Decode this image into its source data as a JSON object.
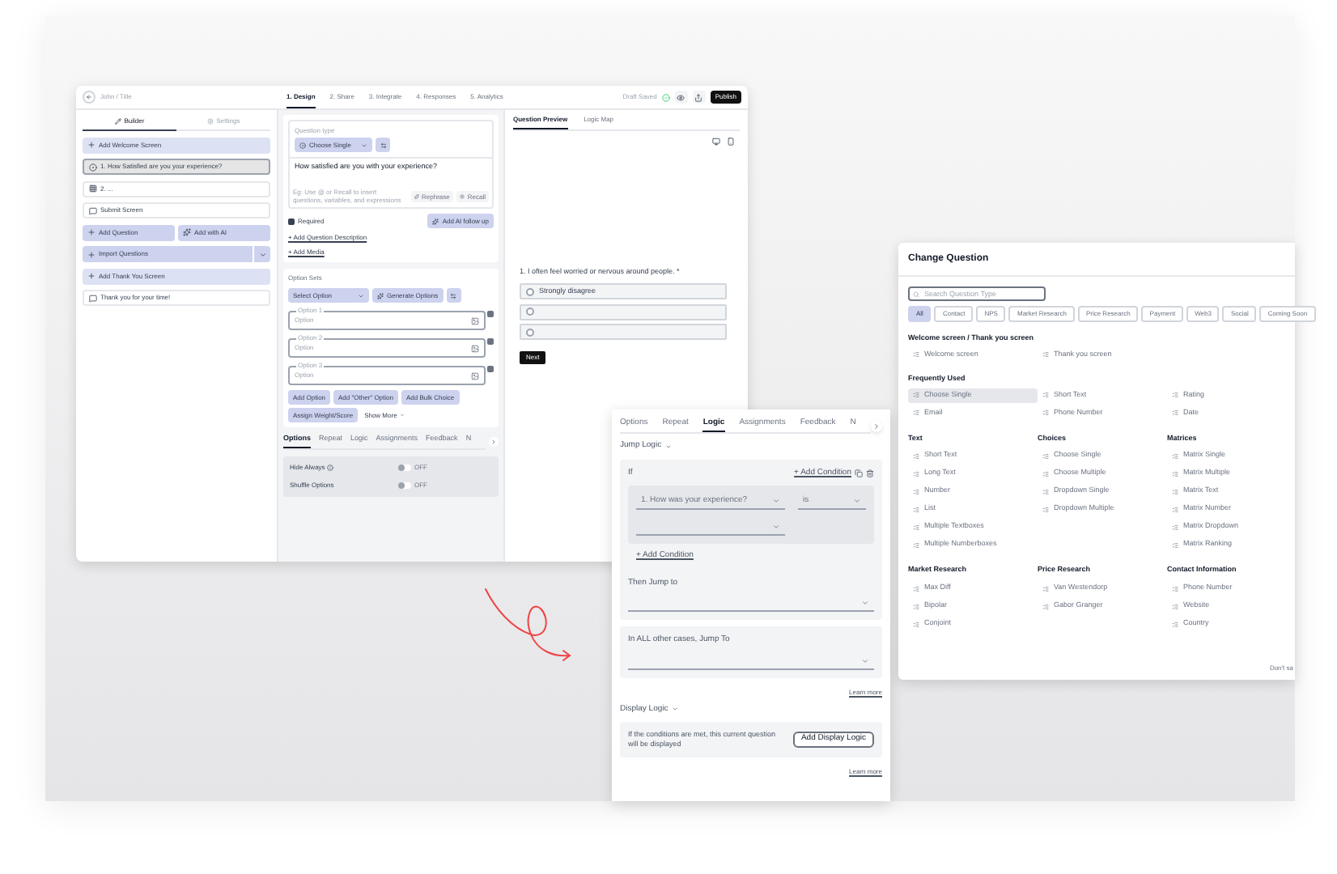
{
  "editor": {
    "breadcrumb": "John / Title",
    "steps": [
      {
        "label": "1. Design",
        "selected": true
      },
      {
        "label": "2. Share",
        "selected": false
      },
      {
        "label": "3. Integrate",
        "selected": false
      },
      {
        "label": "4. Responses",
        "selected": false
      },
      {
        "label": "5. Analytics",
        "selected": false
      }
    ],
    "draft_status": "Draft Saved",
    "publish_button": "Publish",
    "sidebar": {
      "tabs": [
        {
          "label": "Builder",
          "selected": true
        },
        {
          "label": "Settings",
          "selected": false
        }
      ],
      "items": [
        {
          "kind": "add",
          "label": "Add Welcome Screen"
        },
        {
          "kind": "choice",
          "label": "1. How Satisfied are you your experience?",
          "selected": true
        },
        {
          "kind": "matrix",
          "label": "2. ...",
          "selected": false
        },
        {
          "kind": "screen",
          "label": "Submit Screen",
          "selected": false
        },
        {
          "kind": "pair",
          "labels": [
            "Add Question",
            "Add with AI"
          ]
        },
        {
          "kind": "split",
          "label": "Import Questions"
        },
        {
          "kind": "add",
          "label": "Add Thank You Screen"
        },
        {
          "kind": "screen",
          "label": "Thank you for your time!",
          "selected": false
        }
      ]
    },
    "question_card": {
      "type_label": "Question type",
      "type_value": "Choose Single",
      "question_text": "How satisfied are you with your experience?",
      "hint": "Eg: Use @ or Recall to insert questions, variables, and expressions",
      "rephrase_button": "Rephrase",
      "recall_button": "Recall",
      "required": {
        "label": "Required",
        "checked": true
      },
      "ai_button": "Add AI follow up",
      "links": [
        "+ Add Question Description",
        "+ Add Media"
      ]
    },
    "options_card": {
      "label": "Option Sets",
      "select": "Select Option",
      "generate_button": "Generate Options",
      "options": [
        {
          "label": "Option 1",
          "placeholder": "Option"
        },
        {
          "label": "Option 2",
          "placeholder": "Option"
        },
        {
          "label": "Option 3",
          "placeholder": "Option"
        }
      ],
      "buttons": [
        "Add Option",
        "Add \"Other\" Option",
        "Add Bulk Choice",
        "Assign Weight/Score"
      ],
      "show_more": "Show More"
    },
    "settings_tabs": [
      {
        "label": "Options",
        "selected": true
      },
      {
        "label": "Repeat",
        "selected": false
      },
      {
        "label": "Logic",
        "selected": false
      },
      {
        "label": "Assignments",
        "selected": false
      },
      {
        "label": "Feedback",
        "selected": false
      },
      {
        "label": "N",
        "selected": false
      }
    ],
    "toggles": [
      {
        "label": "Hide Always",
        "info_icon": true,
        "on": false,
        "state_text": "OFF"
      },
      {
        "label": "Shuffle Options",
        "info_icon": false,
        "on": false,
        "state_text": "OFF"
      }
    ]
  },
  "preview": {
    "tabs": [
      {
        "label": "Question Preview",
        "selected": true
      },
      {
        "label": "Logic Map",
        "selected": false
      }
    ],
    "question": "1. I often feel worried or nervous around people. *",
    "choices": [
      {
        "label": "Strongly disagree",
        "selected": false
      },
      {
        "selected": false
      },
      {
        "selected": false
      }
    ],
    "next_button": "Next"
  },
  "logic_panel": {
    "tabs": [
      {
        "label": "Options",
        "selected": false
      },
      {
        "label": "Repeat",
        "selected": false
      },
      {
        "label": "Logic",
        "selected": true
      },
      {
        "label": "Assignments",
        "selected": false
      },
      {
        "label": "Feedback",
        "selected": false
      },
      {
        "label": "N",
        "selected": false
      }
    ],
    "jump_logic": "Jump Logic",
    "if_label": "If",
    "add_condition": "+ Add Condition",
    "condition_question": "1. How was your experience?",
    "condition_operator": "is",
    "add_condition_2": "+ Add Condition",
    "then_label": "Then Jump to",
    "other_label": "In ALL other cases, Jump To",
    "learn_more": "Learn more",
    "display_logic": "Display Logic",
    "display_text": "If the conditions are met, this current question will be displayed",
    "display_button": "Add Display Logic",
    "learn_more_2": "Learn more"
  },
  "change_question": {
    "title": "Change Question",
    "search_placeholder": "Search Question Type",
    "filters": [
      {
        "label": "All",
        "selected": true
      },
      {
        "label": "Contact",
        "selected": false
      },
      {
        "label": "NPS",
        "selected": false
      },
      {
        "label": "Market Research",
        "selected": false
      },
      {
        "label": "Price Research",
        "selected": false
      },
      {
        "label": "Payment",
        "selected": false
      },
      {
        "label": "Web3",
        "selected": false
      },
      {
        "label": "Social",
        "selected": false
      },
      {
        "label": "Coming Soon",
        "selected": false
      }
    ],
    "wide_sections": [
      {
        "title": "Welcome screen / Thank you screen",
        "items": [
          {
            "label": "Welcome screen",
            "selected": false
          },
          {
            "label": "Thank you screen",
            "selected": false
          }
        ]
      },
      {
        "title": "Frequently Used",
        "items": [
          {
            "label": "Choose Single",
            "selected": true
          },
          {
            "label": "Short Text",
            "selected": false
          },
          {
            "label": "Rating",
            "selected": false
          },
          {
            "label": "Email",
            "selected": false
          },
          {
            "label": "Phone Number",
            "selected": false
          },
          {
            "label": "Date",
            "selected": false
          }
        ]
      }
    ],
    "column_rows": [
      [
        {
          "title": "Text",
          "items": [
            "Short Text",
            "Long Text",
            "Number",
            "List",
            "Multiple Textboxes",
            "Multiple Numberboxes"
          ]
        },
        {
          "title": "Choices",
          "items": [
            "Choose Single",
            "Choose Multiple",
            "Dropdown Single",
            "Dropdown Multiple"
          ]
        },
        {
          "title": "Matrices",
          "items": [
            "Matrix Single",
            "Matrix Multiple",
            "Matrix Text",
            "Matrix Number",
            "Matrix Dropdown",
            "Matrix Ranking"
          ]
        }
      ],
      [
        {
          "title": "Market Research",
          "items": [
            "Max Diff",
            "Bipolar",
            "Conjoint"
          ]
        },
        {
          "title": "Price Research",
          "items": [
            "Van Westendorp",
            "Gabor Granger"
          ]
        },
        {
          "title": "Contact Information",
          "items": [
            "Phone Number",
            "Website",
            "Country"
          ]
        }
      ]
    ],
    "footer_text": "Don't sa"
  }
}
